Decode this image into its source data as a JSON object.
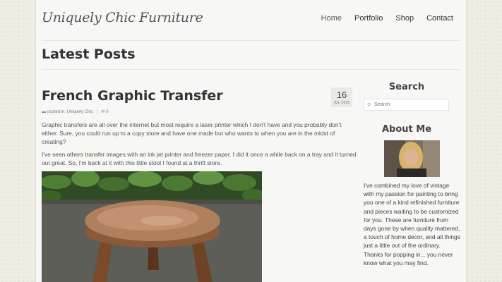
{
  "site": {
    "title": "Uniquely Chic Furniture"
  },
  "nav": {
    "items": [
      "Home",
      "Portfolio",
      "Shop",
      "Contact"
    ]
  },
  "archive": {
    "title": "Latest Posts"
  },
  "post": {
    "title": "French Graphic Transfer",
    "date_day": "16",
    "date_month": "JUL 2015",
    "meta_posted": "posted in: Uniquely Chic",
    "comments": "0",
    "paragraphs": [
      "Graphic transfers are all over the internet but most require a laser printer which I don't have and you probably don't either. Sure, you could run up to a copy store and have one made but who wants to when you are in the midst of creating?",
      "I've seen others transfer images with an ink jet printer and freezer paper. I did it once a while back on a tray and it turned out great. So, I'm back at it with this little stool I found at a thrift store."
    ]
  },
  "sidebar": {
    "search_title": "Search",
    "search_placeholder": "Search",
    "about_title": "About Me",
    "about_text": "I've combined my love of vintage with my passion for painting to bring you one of a kind refinished furniture and pieces waiting to be customized for you. These are furniture from days gone by when quality mattered, a touch of home decor, and all things just a little out of the ordinary. Thanks for popping in... you never know what you may find."
  }
}
